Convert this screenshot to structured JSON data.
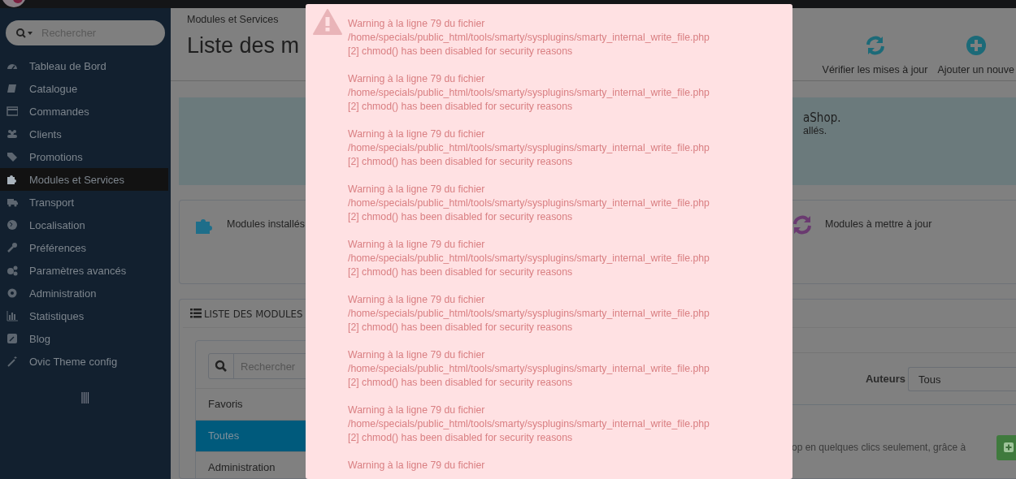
{
  "sidebar": {
    "search": {
      "placeholder": "Rechercher"
    },
    "items": [
      {
        "label": "Tableau de Bord",
        "selected": false
      },
      {
        "label": "Catalogue",
        "selected": false
      },
      {
        "label": "Commandes",
        "selected": false
      },
      {
        "label": "Clients",
        "selected": false
      },
      {
        "label": "Promotions",
        "selected": false
      },
      {
        "label": "Modules et Services",
        "selected": true
      },
      {
        "label": "Transport",
        "selected": false
      },
      {
        "label": "Localisation",
        "selected": false
      },
      {
        "label": "Préférences",
        "selected": false
      },
      {
        "label": "Paramètres avancés",
        "selected": false
      },
      {
        "label": "Administration",
        "selected": false
      },
      {
        "label": "Statistiques",
        "selected": false
      },
      {
        "label": "Blog",
        "selected": false
      },
      {
        "label": "Ovic Theme config",
        "selected": false
      }
    ]
  },
  "header": {
    "breadcrumb": "Modules et Services",
    "title": "Liste des m",
    "toolbar": [
      {
        "kind": "refresh",
        "label": "Vérifier les mises à jour"
      },
      {
        "kind": "add",
        "label": "Ajouter un nouve"
      }
    ]
  },
  "info_panel": {
    "lines": [
      "aShop.",
      "allés."
    ]
  },
  "stats": [
    {
      "kind": "installed",
      "label": "Modules installés"
    },
    {
      "kind": "update",
      "label": "Modules à mettre à jour"
    }
  ],
  "module_list": {
    "title": "LISTE DES MODULES",
    "search": {
      "placeholder": "Rechercher"
    },
    "categories": [
      {
        "label": "Favoris",
        "selected": false
      },
      {
        "label": "Toutes",
        "selected": true
      },
      {
        "label": "Administration",
        "selected": false
      }
    ],
    "authors": {
      "label": "Auteurs",
      "value": "Tous"
    },
    "promo_text": "op en quelques clics seulement, grâce à"
  },
  "modal": {
    "warnings": [
      {
        "lines": [
          "Warning à la ligne 79 du fichier",
          "/home/specials/public_html/tools/smarty/sysplugins/smarty_internal_write_file.php",
          "[2] chmod() has been disabled for security reasons"
        ]
      },
      {
        "lines": [
          "Warning à la ligne 79 du fichier",
          "/home/specials/public_html/tools/smarty/sysplugins/smarty_internal_write_file.php",
          "[2] chmod() has been disabled for security reasons"
        ]
      },
      {
        "lines": [
          "Warning à la ligne 79 du fichier",
          "/home/specials/public_html/tools/smarty/sysplugins/smarty_internal_write_file.php",
          "[2] chmod() has been disabled for security reasons"
        ]
      },
      {
        "lines": [
          "Warning à la ligne 79 du fichier",
          "/home/specials/public_html/tools/smarty/sysplugins/smarty_internal_write_file.php",
          "[2] chmod() has been disabled for security reasons"
        ]
      },
      {
        "lines": [
          "Warning à la ligne 79 du fichier",
          "/home/specials/public_html/tools/smarty/sysplugins/smarty_internal_write_file.php",
          "[2] chmod() has been disabled for security reasons"
        ]
      },
      {
        "lines": [
          "Warning à la ligne 79 du fichier",
          "/home/specials/public_html/tools/smarty/sysplugins/smarty_internal_write_file.php",
          "[2] chmod() has been disabled for security reasons"
        ]
      },
      {
        "lines": [
          "Warning à la ligne 79 du fichier",
          "/home/specials/public_html/tools/smarty/sysplugins/smarty_internal_write_file.php",
          "[2] chmod() has been disabled for security reasons"
        ]
      },
      {
        "lines": [
          "Warning à la ligne 79 du fichier",
          "/home/specials/public_html/tools/smarty/sysplugins/smarty_internal_write_file.php",
          "[2] chmod() has been disabled for security reasons"
        ]
      },
      {
        "lines": [
          "Warning à la ligne 79 du fichier"
        ]
      }
    ]
  }
}
